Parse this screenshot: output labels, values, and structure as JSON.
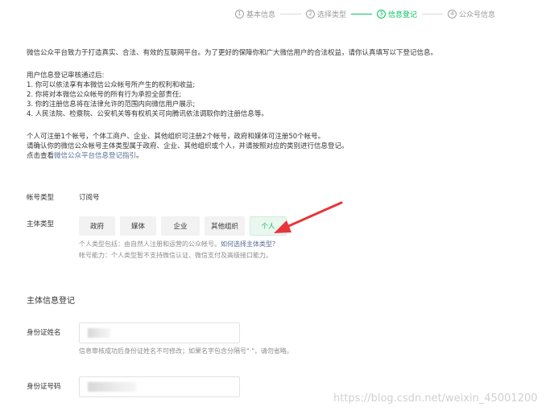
{
  "steps": [
    {
      "num": "1",
      "label": "基本信息",
      "active": false
    },
    {
      "num": "2",
      "label": "选择类型",
      "active": false
    },
    {
      "num": "3",
      "label": "信息登记",
      "active": true
    },
    {
      "num": "4",
      "label": "公众号信息",
      "active": false
    }
  ],
  "intro": {
    "line1": "微信公众平台致力于打造真实、合法、有效的互联网平台。为了更好的保障你和广大微信用户的合法权益，请你认真填写以下登记信息。"
  },
  "verify": {
    "heading": "用户信息登记审核通过后:",
    "item1": "1. 你可以依法享有本微信公众帐号所产生的权利和收益;",
    "item2": "2. 你将对本微信公众帐号的所有行为承担全部责任;",
    "item3": "3. 你的注册信息将在法律允许的范围内向微信用户展示;",
    "item4": "4. 人民法院、检察院、公安机关等有权机关可向腾讯依法调取你的注册信息等。"
  },
  "notes": {
    "line1": "个人可注册1个帐号，个体工商户、企业、其他组织可注册2个帐号，政府和媒体可注册50个帐号。",
    "line2": "请确认你的微信公众帐号主体类型属于政府、企业、其他组织或个人，并请按照对应的类别进行信息登记。",
    "link_prefix": "点击查看",
    "link_text": "微信公众平台信息登记指引",
    "link_suffix": "。"
  },
  "account_type": {
    "label": "帐号类型",
    "value": "订阅号"
  },
  "subject_type": {
    "label": "主体类型",
    "options": [
      "政府",
      "媒体",
      "企业",
      "其他组织",
      "个人"
    ],
    "selected": "个人"
  },
  "hints": {
    "line1_prefix": "个人类型包括：由自然人注册和运营的公众帐号。",
    "line1_link": "如何选择主体类型?",
    "line2": "帐号能力：个人类型暂不支持微信认证、微信支付及高级接口能力。"
  },
  "section": {
    "title": "主体信息登记"
  },
  "id_name": {
    "label": "身份证姓名",
    "hint": "信息审核成功后身份证姓名不可修改；如果名字包含分隔号\"·\"，请勿省略。"
  },
  "id_number": {
    "label": "身份证号码"
  },
  "watermark": "https://blog.csdn.net/weixin_45001200",
  "colors": {
    "accent": "#07c160",
    "link": "#576b95",
    "arrow": "#e8353a"
  }
}
